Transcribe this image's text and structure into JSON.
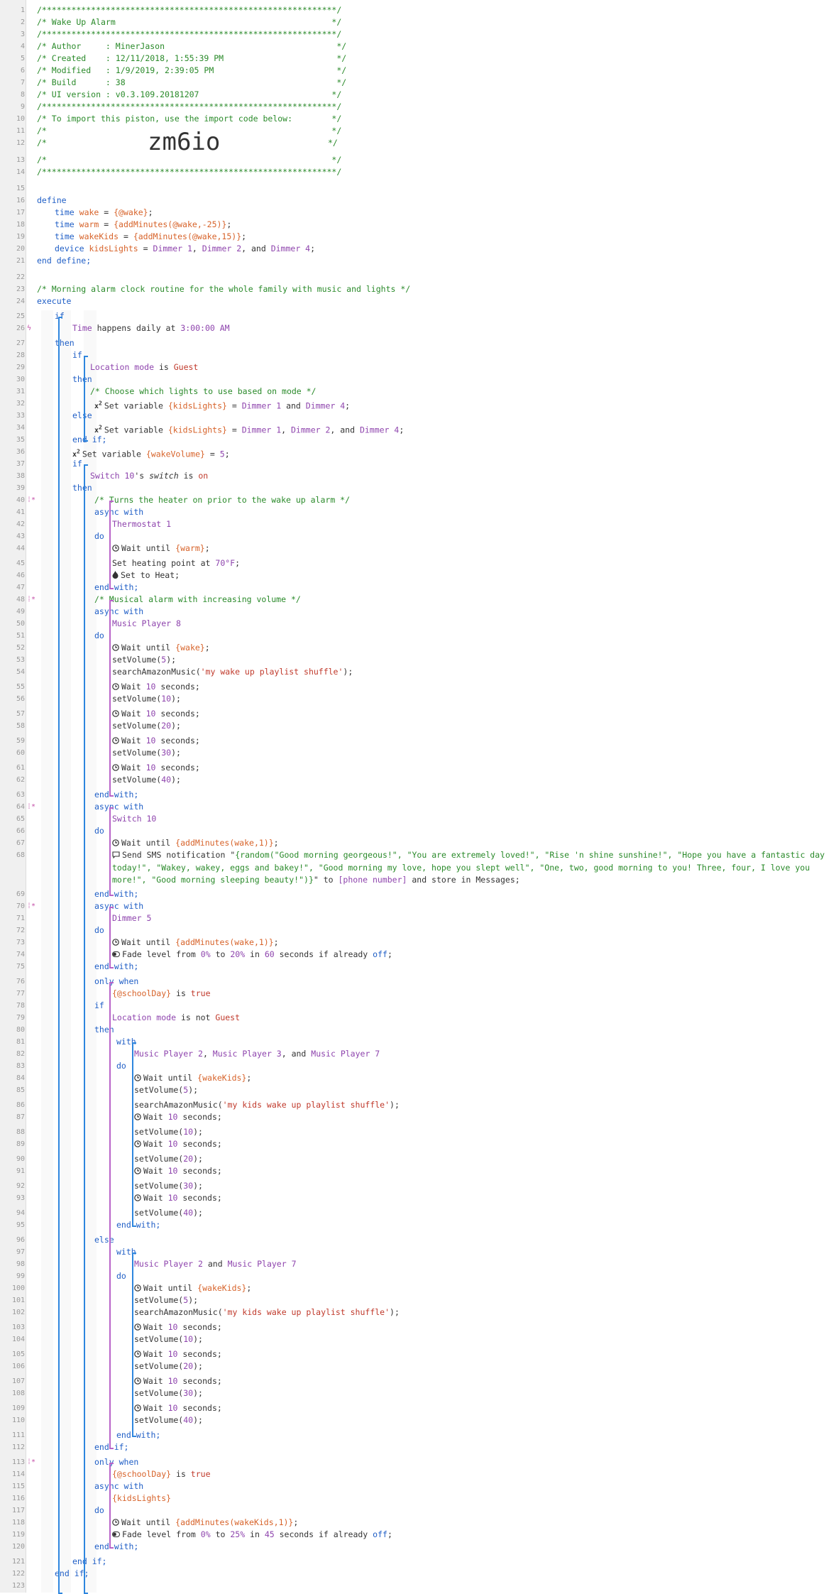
{
  "header": {
    "border": "/************************************************************/",
    "title": "/* Wake Up Alarm                                            */",
    "author": "/* Author     : MinerJason                                   */",
    "created": "/* Created    : 12/11/2018, 1:55:39 PM                       */",
    "modified": "/* Modified   : 1/9/2019, 2:39:05 PM                         */",
    "build": "/* Build      : 38                                           */",
    "ui_version": "/* UI version : v0.3.109.20181207                           */",
    "import_note": "/* To import this piston, use the import code below:        */",
    "blank": "/*                                                          */",
    "import_code_prefix": "/*",
    "import_code": "zm6io",
    "import_code_suffix": "*/"
  },
  "define": {
    "kw_define": "define",
    "kw_time": "time",
    "kw_device": "device",
    "wake_name": "wake",
    "wake_value": "{@wake}",
    "warm_name": "warm",
    "warm_value": "{addMinutes(@wake,-25)}",
    "wakekids_name": "wakeKids",
    "wakekids_value": "{addMinutes(@wake,15)}",
    "kidslights_name": "kidsLights",
    "d1": "Dimmer 1",
    "d2": "Dimmer 2",
    "d4": "Dimmer 4",
    "end_define": "end define;"
  },
  "comments": {
    "routine": "/* Morning alarm clock routine for the whole family with music and lights */",
    "choose_lights": "/* Choose which lights to use based on mode */",
    "heater": "/* Turns the heater on prior to the wake up alarm */",
    "musical": "/* Musical alarm with increasing volume */"
  },
  "keywords": {
    "execute": "execute",
    "if": "if",
    "then": "then",
    "else": "else",
    "end_if": "end if;",
    "async_with": "async with",
    "with": "with",
    "do": "do",
    "end_with": "end with;",
    "only_when": "only when"
  },
  "code": {
    "time_dev": "Time",
    "happens_daily": " happens daily at ",
    "time_value": "3:00:00 AM",
    "location_mode": "Location mode",
    "is": " is ",
    "is_not": " is not ",
    "guest": "Guest",
    "set_variable": "Set variable ",
    "kidslights_ref": "{kidsLights}",
    "eq": " = ",
    "and": " and ",
    "comma": ", ",
    "comma_and": ", and ",
    "semi": ";",
    "wakevolume_ref": "{wakeVolume}",
    "five": "5",
    "switch10": "Switch 10",
    "switch_possessive": "'s ",
    "switch_attr": "switch",
    "on": "on",
    "thermostat": "Thermostat 1",
    "wait_until": "Wait until ",
    "warm_ref": "{warm}",
    "wake_ref": "{wake}",
    "wakekids_ref": "{wakeKids}",
    "heating_point": "Set heating point at ",
    "heating_value": "70°F",
    "set_to_heat": "Set to Heat;",
    "music8": "Music Player 8",
    "set_volume": "setVolume(",
    "close_paren": ");",
    "search_amazon": "searchAmazonMusic(",
    "playlist": "'my wake up playlist shuffle'",
    "kids_playlist": "'my kids wake up playlist shuffle'",
    "wait": "Wait ",
    "ten": "10",
    "seconds": " seconds;",
    "addminutes_wake": "{addMinutes(wake,1)}",
    "addminutes_wakekids": "{addMinutes(wakeKids,1)}",
    "send_sms": "Send SMS notification \"",
    "sms_body": "{random(\"Good morning georgeous!\", \"You are extremely loved!\", \"Rise 'n shine sunshine!\", \"Hope you have a fantastic day today!\", \"Wakey, wakey, eggs and bakey!\", \"Good morning my love, hope you slept well\", \"One, two, good morning to you! Three, four, I love you more!\", \"Good morning sleeping beauty!\")}",
    "sms_to": "\" to ",
    "phone": "[phone number]",
    "store_messages": " and store in Messages;",
    "dimmer5": "Dimmer 5",
    "fade_from": "Fade level from ",
    "zero_pct": "0%",
    "to": " to ",
    "twenty_pct": "20%",
    "twentyfive_pct": "25%",
    "in": " in ",
    "sixty": "60",
    "fortyfive": "45",
    "seconds_if": " seconds if already ",
    "off": "off",
    "schoolday": "{@schoolDay}",
    "is_true": " is true",
    "true": "true",
    "mp2": "Music Player 2",
    "mp3": "Music Player 3",
    "mp7": "Music Player 7"
  },
  "volumes": [
    "5",
    "10",
    "20",
    "30",
    "40"
  ],
  "icons": {
    "trigger": "lightning-icon",
    "variable": "x2-icon",
    "clock": "clock-icon",
    "flame": "flame-icon",
    "message": "message-icon",
    "dimmer": "dimmer-icon"
  }
}
